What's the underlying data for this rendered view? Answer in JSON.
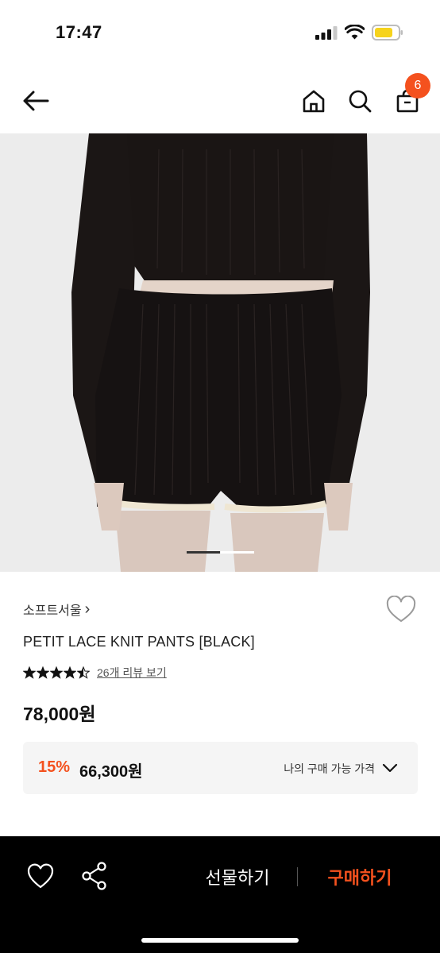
{
  "status_bar": {
    "time": "17:47"
  },
  "nav": {
    "cart_count": "6"
  },
  "product": {
    "brand": "소프트서울",
    "brand_chevron": "›",
    "name": "PETIT LACE KNIT PANTS [BLACK]",
    "rating": 4.5,
    "review_link": "26개 리뷰 보기",
    "price": "78,000원",
    "discount_rate": "15%",
    "discount_price": "66,300원",
    "my_price_label": "나의 구매 가능 가격"
  },
  "gallery": {
    "current_slide": 1,
    "total_slides": 2
  },
  "bottom_bar": {
    "gift_label": "선물하기",
    "buy_label": "구매하기"
  },
  "colors": {
    "accent": "#f4511e",
    "bottom_bar_bg": "#000000",
    "discount_box_bg": "#f5f5f5",
    "image_bg": "#ececec"
  },
  "icons": [
    "back-arrow-icon",
    "home-icon",
    "search-icon",
    "shopping-bag-icon",
    "heart-icon",
    "share-icon",
    "star-icon",
    "chevron-down-icon"
  ]
}
